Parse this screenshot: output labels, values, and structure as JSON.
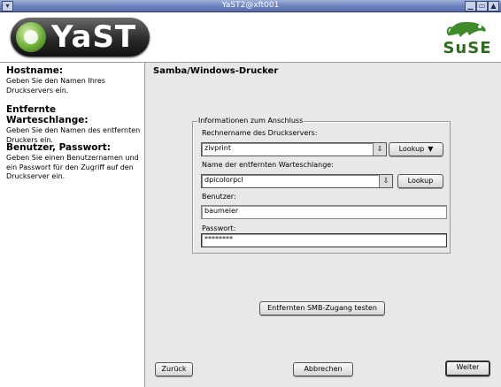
{
  "window": {
    "title": "YaST2@xft001",
    "controls": [
      "restore-icon",
      "maximize-icon",
      "close-icon"
    ]
  },
  "header": {
    "left_logo_text": "YaST",
    "right_logo_text": "SuSE"
  },
  "help": {
    "sections": [
      {
        "title": "Hostname:",
        "text": "Geben Sie den Namen Ihres Druckservers ein."
      },
      {
        "title": "Entfernte Warteschlange:",
        "text": "Geben Sie den Namen des entfernten Druckers ein."
      },
      {
        "title": "Benutzer, Passwort:",
        "text": "Geben Sie einen Benutzernamen und ein Passwort für den Zugriff auf den Druckserver ein."
      }
    ]
  },
  "dialog": {
    "title": "Samba/Windows-Drucker",
    "group_title": "Informationen zum Anschluss",
    "server": {
      "label": "Rechnername des Druckservers:",
      "value": "zivprint",
      "lookup": "Lookup"
    },
    "queue": {
      "label": "Name der entfernten Warteschlange:",
      "value": "dpicolorpcl",
      "lookup": "Lookup"
    },
    "user": {
      "label": "Benutzer:",
      "value": "baumeier"
    },
    "password": {
      "label": "Passwort:",
      "value": "********"
    },
    "test_button": "Entfernten SMB-Zugang testen"
  },
  "footer": {
    "back": "Zurück",
    "cancel": "Abbrechen",
    "next": "Weiter"
  }
}
